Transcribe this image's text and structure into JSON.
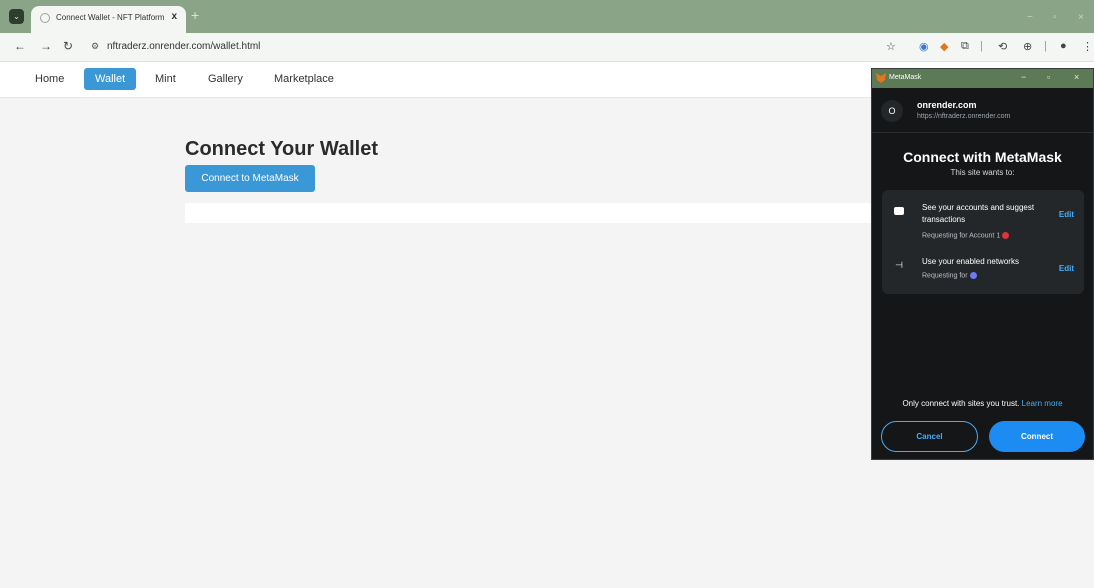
{
  "browser": {
    "tab_title": "Connect Wallet - NFT Platform",
    "tab_close": "x",
    "new_tab": "+",
    "url": "nftraderz.onrender.com/wallet.html",
    "window_controls": [
      "−",
      "▫",
      "×"
    ]
  },
  "nav": {
    "items": [
      "Home",
      "Wallet",
      "Mint",
      "Gallery",
      "Marketplace"
    ],
    "active": "Wallet"
  },
  "main": {
    "title": "Connect Your Wallet",
    "connect_button": "Connect to MetaMask"
  },
  "metamask": {
    "window_title": "MetaMask",
    "site_initial": "O",
    "site_name": "onrender.com",
    "site_url": "https://nftraderz.onrender.com",
    "heading": "Connect with MetaMask",
    "subheading": "This site wants to:",
    "permissions": [
      {
        "text": "See your accounts and suggest transactions",
        "request": "Requesting for Account 1",
        "edit": "Edit",
        "icon": "wallet-icon"
      },
      {
        "text": "Use your enabled networks",
        "request": "Requesting for",
        "edit": "Edit",
        "icon": "network-icon"
      }
    ],
    "trust_text": "Only connect with sites you trust.",
    "learn_more": "Learn more",
    "cancel": "Cancel",
    "connect": "Connect"
  },
  "colors": {
    "chrome": "#8aa487",
    "accent": "#3a98d6",
    "mm_bg": "#141618",
    "mm_blue": "#1c8cf2"
  }
}
